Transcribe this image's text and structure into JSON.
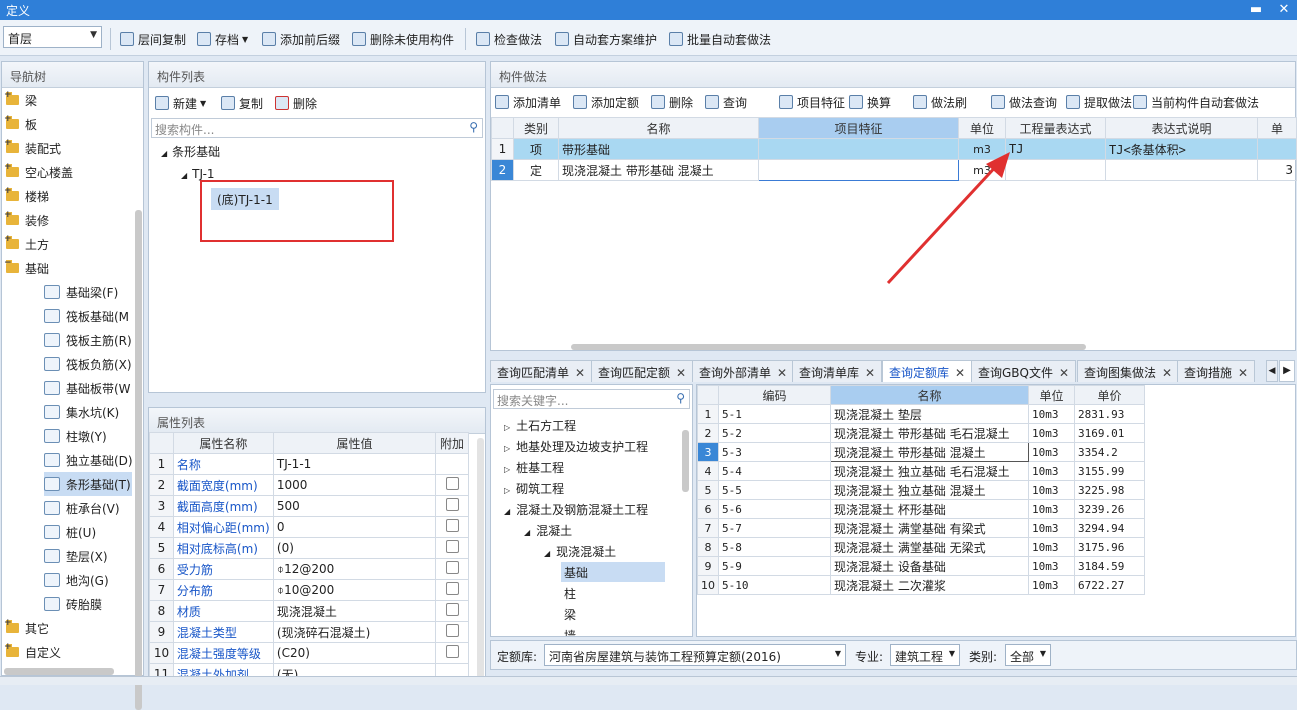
{
  "window": {
    "title": "定义",
    "min": "▬",
    "close": "✕"
  },
  "toolbar": {
    "floor": "首层",
    "items": [
      "层间复制",
      "存档",
      "添加前后缀",
      "删除未使用构件",
      "检查做法",
      "自动套方案维护",
      "批量自动套做法"
    ]
  },
  "nav": {
    "title": "导航树",
    "items": [
      {
        "label": "梁",
        "type": "folder",
        "expand": "+"
      },
      {
        "label": "板",
        "type": "folder",
        "expand": "+"
      },
      {
        "label": "装配式",
        "type": "folder",
        "expand": "+"
      },
      {
        "label": "空心楼盖",
        "type": "folder",
        "expand": "+"
      },
      {
        "label": "楼梯",
        "type": "folder",
        "expand": "+"
      },
      {
        "label": "装修",
        "type": "folder",
        "expand": "+"
      },
      {
        "label": "土方",
        "type": "folder",
        "expand": "+"
      },
      {
        "label": "基础",
        "type": "folder",
        "expand": "−"
      },
      {
        "label": "基础梁(F)",
        "type": "child"
      },
      {
        "label": "筏板基础(M",
        "type": "child"
      },
      {
        "label": "筏板主筋(R)",
        "type": "child"
      },
      {
        "label": "筏板负筋(X)",
        "type": "child"
      },
      {
        "label": "基础板带(W",
        "type": "child"
      },
      {
        "label": "集水坑(K)",
        "type": "child"
      },
      {
        "label": "柱墩(Y)",
        "type": "child"
      },
      {
        "label": "独立基础(D)",
        "type": "child"
      },
      {
        "label": "条形基础(T)",
        "type": "child",
        "selected": true
      },
      {
        "label": "桩承台(V)",
        "type": "child"
      },
      {
        "label": "桩(U)",
        "type": "child"
      },
      {
        "label": "垫层(X)",
        "type": "child"
      },
      {
        "label": "地沟(G)",
        "type": "child"
      },
      {
        "label": "砖胎膜",
        "type": "child"
      },
      {
        "label": "其它",
        "type": "folder",
        "expand": "+"
      },
      {
        "label": "自定义",
        "type": "folder",
        "expand": "+"
      }
    ]
  },
  "components": {
    "title": "构件列表",
    "new": "新建",
    "copy": "复制",
    "delete": "删除",
    "search_placeholder": "搜索构件...",
    "tree_root": "条形基础",
    "tree_child": "TJ-1",
    "tree_leaf": "(底)TJ-1-1"
  },
  "props": {
    "title": "属性列表",
    "headers": [
      "属性名称",
      "属性值",
      "附加"
    ],
    "rows": [
      {
        "n": "1",
        "name": "名称",
        "value": "TJ-1-1",
        "chk": false
      },
      {
        "n": "2",
        "name": "截面宽度(mm)",
        "value": "1000",
        "chk": true
      },
      {
        "n": "3",
        "name": "截面高度(mm)",
        "value": "500",
        "chk": true
      },
      {
        "n": "4",
        "name": "相对偏心距(mm)",
        "value": "0",
        "chk": true
      },
      {
        "n": "5",
        "name": "相对底标高(m)",
        "value": "(0)",
        "chk": true
      },
      {
        "n": "6",
        "name": "受力筋",
        "value": "⌽12@200",
        "chk": true
      },
      {
        "n": "7",
        "name": "分布筋",
        "value": "⌽10@200",
        "chk": true
      },
      {
        "n": "8",
        "name": "材质",
        "value": "现浇混凝土",
        "chk": true
      },
      {
        "n": "9",
        "name": "混凝土类型",
        "value": "(现浇碎石混凝土)",
        "chk": true
      },
      {
        "n": "10",
        "name": "混凝土强度等级",
        "value": "(C20)",
        "chk": true
      },
      {
        "n": "11",
        "name": "混凝土外加剂",
        "value": "(无)",
        "chk": false
      }
    ]
  },
  "method": {
    "title": "构件做法",
    "tools": [
      "添加清单",
      "添加定额",
      "删除",
      "查询",
      "项目特征",
      "换算",
      "做法刷",
      "做法查询",
      "提取做法",
      "当前构件自动套做法"
    ],
    "headers": [
      "类别",
      "名称",
      "项目特征",
      "单位",
      "工程量表达式",
      "表达式说明",
      "单"
    ],
    "rows": [
      {
        "n": "1",
        "type": "项",
        "name": "带形基础",
        "feature": "",
        "unit": "m3",
        "expr": "TJ",
        "desc": "TJ<条基体积>",
        "price": ""
      },
      {
        "n": "2",
        "type": "定",
        "name": "现浇混凝土 带形基础 混凝土",
        "feature": "",
        "unit": "m3",
        "expr": "",
        "desc": "",
        "price": "3"
      }
    ]
  },
  "lower_tabs": [
    "查询匹配清单",
    "查询匹配定额",
    "查询外部清单",
    "查询清单库",
    "查询定额库",
    "查询GBQ文件",
    "查询图集做法",
    "查询措施"
  ],
  "quota_tree": {
    "search_placeholder": "搜索关键字...",
    "items": [
      {
        "label": "土石方工程",
        "level": 0,
        "arrow": "▷"
      },
      {
        "label": "地基处理及边坡支护工程",
        "level": 0,
        "arrow": "▷"
      },
      {
        "label": "桩基工程",
        "level": 0,
        "arrow": "▷"
      },
      {
        "label": "砌筑工程",
        "level": 0,
        "arrow": "▷"
      },
      {
        "label": "混凝土及钢筋混凝土工程",
        "level": 0,
        "arrow": "◢"
      },
      {
        "label": "混凝土",
        "level": 1,
        "arrow": "◢"
      },
      {
        "label": "现浇混凝土",
        "level": 2,
        "arrow": "◢"
      },
      {
        "label": "基础",
        "level": 3,
        "arrow": "",
        "selected": true
      },
      {
        "label": "柱",
        "level": 3,
        "arrow": ""
      },
      {
        "label": "梁",
        "level": 3,
        "arrow": ""
      },
      {
        "label": "墙",
        "level": 3,
        "arrow": ""
      }
    ]
  },
  "quota_table": {
    "headers": [
      "编码",
      "名称",
      "单位",
      "单价"
    ],
    "rows": [
      {
        "n": "1",
        "code": "5-1",
        "name": "现浇混凝土 垫层",
        "unit": "10m3",
        "price": "2831.93"
      },
      {
        "n": "2",
        "code": "5-2",
        "name": "现浇混凝土 带形基础 毛石混凝土",
        "unit": "10m3",
        "price": "3169.01"
      },
      {
        "n": "3",
        "code": "5-3",
        "name": "现浇混凝土 带形基础 混凝土",
        "unit": "10m3",
        "price": "3354.2"
      },
      {
        "n": "4",
        "code": "5-4",
        "name": "现浇混凝土 独立基础 毛石混凝土",
        "unit": "10m3",
        "price": "3155.99"
      },
      {
        "n": "5",
        "code": "5-5",
        "name": "现浇混凝土 独立基础 混凝土",
        "unit": "10m3",
        "price": "3225.98"
      },
      {
        "n": "6",
        "code": "5-6",
        "name": "现浇混凝土 杯形基础",
        "unit": "10m3",
        "price": "3239.26"
      },
      {
        "n": "7",
        "code": "5-7",
        "name": "现浇混凝土 满堂基础 有梁式",
        "unit": "10m3",
        "price": "3294.94"
      },
      {
        "n": "8",
        "code": "5-8",
        "name": "现浇混凝土 满堂基础 无梁式",
        "unit": "10m3",
        "price": "3175.96"
      },
      {
        "n": "9",
        "code": "5-9",
        "name": "现浇混凝土 设备基础",
        "unit": "10m3",
        "price": "3184.59"
      },
      {
        "n": "10",
        "code": "5-10",
        "name": "现浇混凝土 二次灌浆",
        "unit": "10m3",
        "price": "6722.27"
      }
    ]
  },
  "bottom": {
    "lib_label": "定额库:",
    "lib_value": "河南省房屋建筑与装饰工程预算定额(2016)",
    "major_label": "专业:",
    "major_value": "建筑工程",
    "cat_label": "类别:",
    "cat_value": "全部"
  },
  "colors": {
    "accent": "#2f7fd8",
    "link": "#1856c8",
    "annotation": "#e03030",
    "selection": "#c8dcf3"
  }
}
